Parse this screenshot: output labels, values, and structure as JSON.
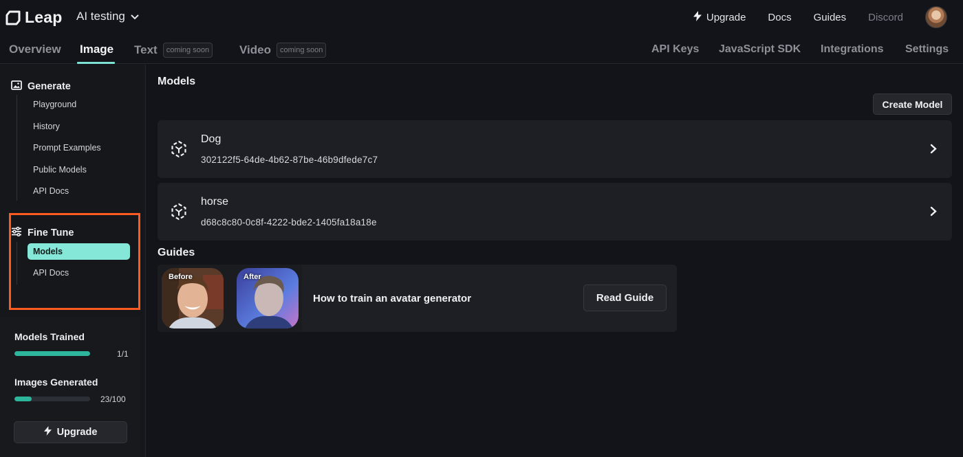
{
  "header": {
    "logo": "Leap",
    "project": "AI testing",
    "links": {
      "upgrade": "Upgrade",
      "docs": "Docs",
      "guides": "Guides",
      "discord": "Discord"
    }
  },
  "tabs": {
    "overview": "Overview",
    "image": "Image",
    "text": "Text",
    "text_badge": "coming soon",
    "video": "Video",
    "video_badge": "coming soon",
    "api_keys": "API Keys",
    "sdk": "JavaScript SDK",
    "integrations": "Integrations",
    "settings": "Settings"
  },
  "sidebar": {
    "generate": {
      "title": "Generate",
      "items": [
        "Playground",
        "History",
        "Prompt Examples",
        "Public Models",
        "API Docs"
      ]
    },
    "fine_tune": {
      "title": "Fine Tune",
      "items": [
        "Models",
        "API Docs"
      ]
    },
    "stats": {
      "models_trained": {
        "label": "Models Trained",
        "count": "1/1",
        "fraction": 1.0
      },
      "images_generated": {
        "label": "Images Generated",
        "count": "23/100",
        "fraction": 0.23
      }
    },
    "upgrade_button": "Upgrade"
  },
  "main": {
    "models_title": "Models",
    "create_button": "Create Model",
    "models": [
      {
        "name": "Dog",
        "id": "302122f5-64de-4b62-87be-46b9dfede7c7"
      },
      {
        "name": "horse",
        "id": "d68c8c80-0c8f-4222-bde2-1405fa18a18e"
      }
    ],
    "guides_title": "Guides",
    "guide": {
      "before_label": "Before",
      "after_label": "After",
      "title": "How to train an avatar generator",
      "button": "Read Guide"
    }
  },
  "colors": {
    "accent": "#84e7d8",
    "progress": "#2eb69d",
    "highlight": "#ff5a1f"
  }
}
